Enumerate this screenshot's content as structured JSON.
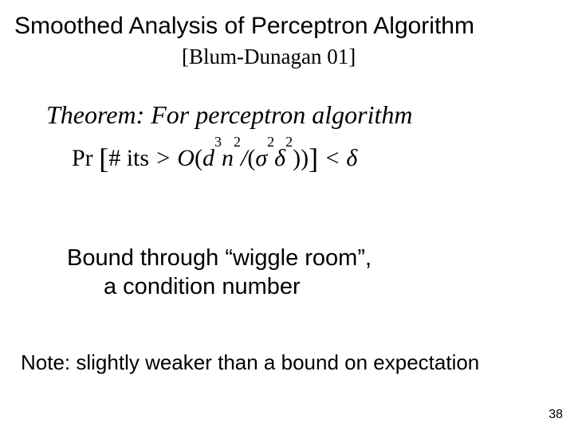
{
  "title": "Smoothed Analysis of Perceptron Algorithm",
  "citation": "[Blum-Dunagan 01]",
  "theorem_line": "Theorem: For perceptron algorithm",
  "formula": {
    "prefix": "Pr",
    "inner_prefix": "# its",
    "gt": ">",
    "bigO": "O",
    "d": "d",
    "d_exp": "3",
    "n": "n",
    "n_exp": "2",
    "sigma": "σ",
    "sigma_exp": "2",
    "delta_inner": "δ",
    "delta_exp": "2",
    "lt": "<",
    "delta_rhs": "δ"
  },
  "bound_line1": "Bound through “wiggle room”,",
  "bound_line2": "a condition number",
  "note": "Note: slightly weaker than a bound on expectation",
  "page_number": "38"
}
